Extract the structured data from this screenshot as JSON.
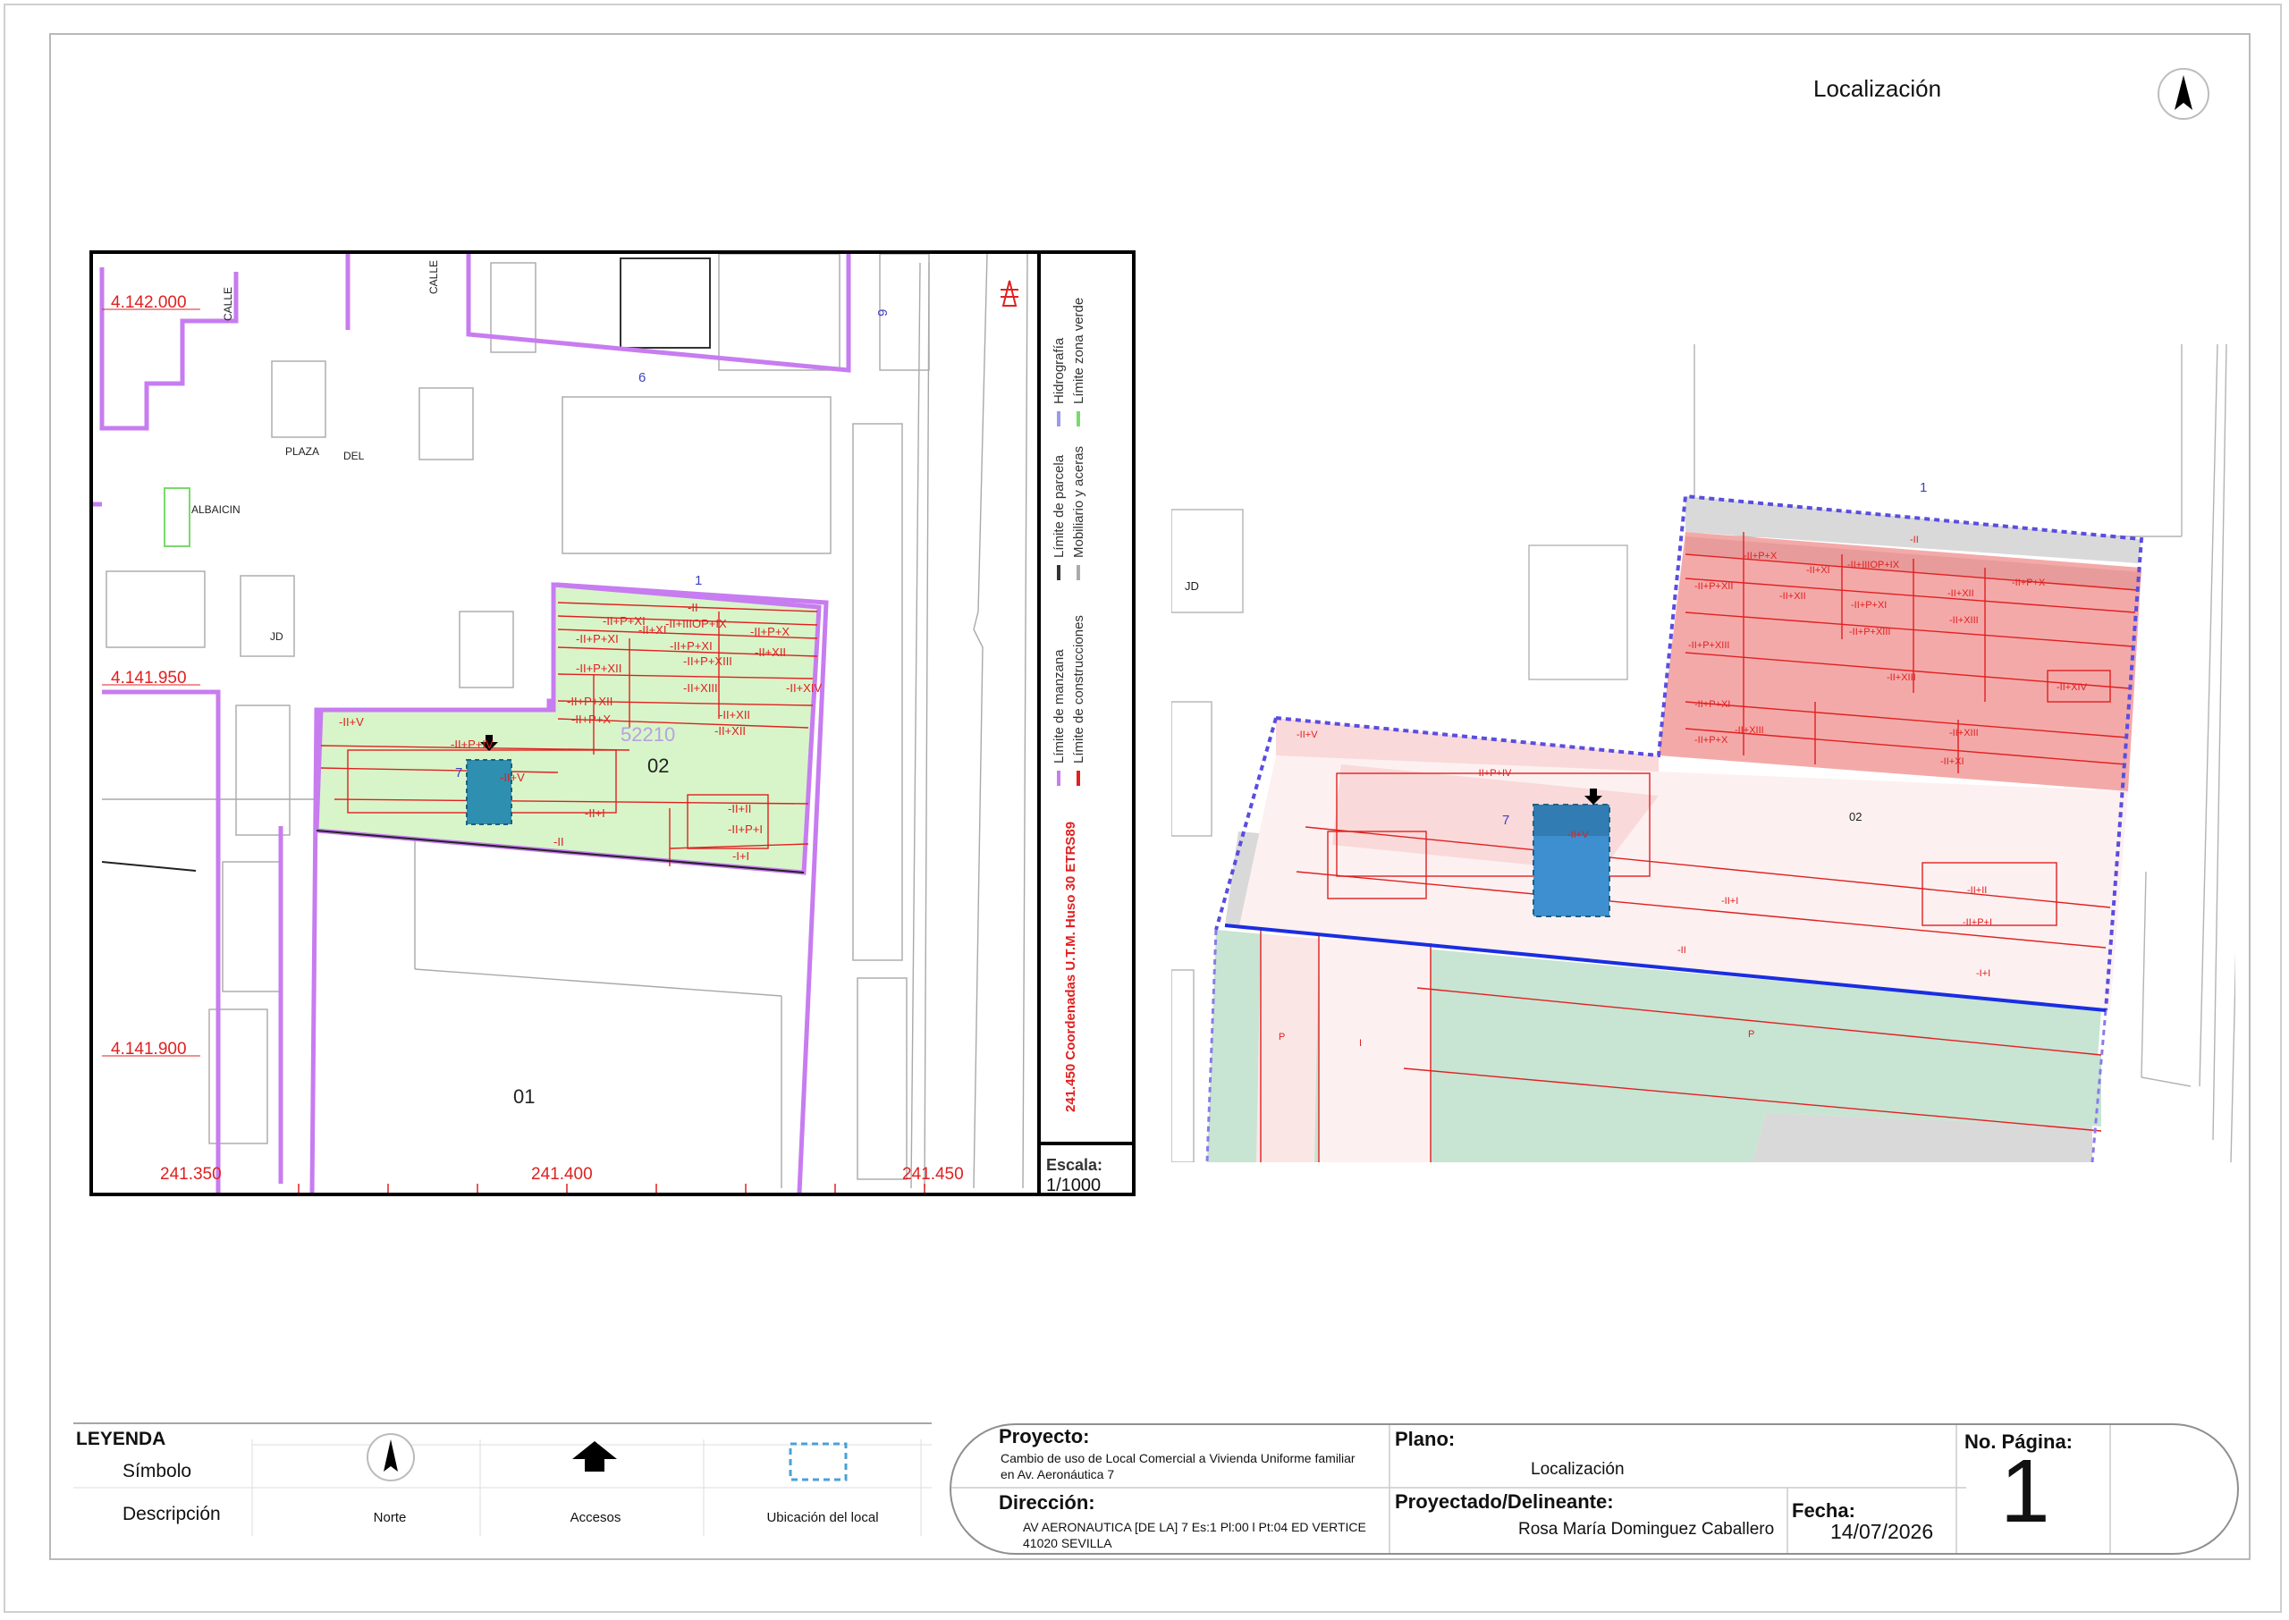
{
  "sheet": {
    "title": "Localización"
  },
  "left_map": {
    "coords": {
      "y_top": "4.142.000",
      "y_mid": "4.141.950",
      "y_low": "4.141.900",
      "x_left": "241.350",
      "x_mid": "241.400",
      "x_right": "241.450"
    },
    "street_labels": [
      "CALLE",
      "CALLE",
      "PLAZA",
      "DEL",
      "ALBAICIN",
      "JD"
    ],
    "parcel_numbers": [
      "6",
      "9",
      "1",
      "7"
    ],
    "block_codes": [
      "02",
      "01",
      "52210"
    ],
    "construction_codes": [
      "-II+V",
      "-II+P+IV",
      "-II+V",
      "-II+I",
      "-II",
      "-II+II",
      "-II+P+I",
      "-I+I",
      "-II",
      "-II+P+XI",
      "-II+XI",
      "-II+P+XI",
      "-II+P+XII",
      "-II+XIII",
      "-II+XII",
      "-II+XIV",
      "-II+P+XII",
      "-II+P+X",
      "-II+P+XI",
      "-II+XIII",
      "-II+XII",
      "-II+IIIOP+IX"
    ],
    "side_legend": {
      "items": [
        "Límite de manzana",
        "Límite de construcciones",
        "Límite de parcela",
        "Mobiliario y aceras",
        "Hidrografía",
        "Límite zona verde"
      ],
      "coordinate_note": "241.450 Coordenadas U.T.M. Huso 30 ETRS89",
      "scale_label": "Escala:",
      "scale_value": "1/1000"
    }
  },
  "right_map": {
    "labels": [
      "1",
      "JD",
      "7",
      "02"
    ],
    "construction_codes": [
      "-II",
      "-II+P+X",
      "-II+XI",
      "-II+IIIOP+IX",
      "-II+P+XII",
      "-II+XII",
      "-II+P+XI",
      "-II+XII",
      "-II+P+X",
      "-II+P+XIII",
      "-II+XIII",
      "-II+XIV",
      "-II+P+XI",
      "-II+XIII",
      "-II+P+X",
      "-II+XIII",
      "-II+XI",
      "-II+V",
      "-II+P+IV",
      "-II+V",
      "-II+I",
      "-II+II",
      "-II+P+I",
      "-II",
      "-I+I",
      "P",
      "I",
      "P"
    ]
  },
  "legend": {
    "title": "LEYENDA",
    "row_symbol": "Símbolo",
    "row_description": "Descripción",
    "items": [
      {
        "icon": "north-arrow-icon",
        "label": "Norte"
      },
      {
        "icon": "access-arrow-icon",
        "label": "Accesos"
      },
      {
        "icon": "dashed-rectangle-icon",
        "label": "Ubicación del local"
      }
    ]
  },
  "title_block": {
    "proyecto_label": "Proyecto:",
    "proyecto_line1": "Cambio de uso de Local Comercial a Vivienda Uniforme familiar",
    "proyecto_line2": "en Av. Aeronáutica 7",
    "plano_label": "Plano:",
    "plano_value": "Localización",
    "pagina_label": "No. Página:",
    "pagina_value": "1",
    "direccion_label": "Dirección:",
    "direccion_line1": "AV AERONAUTICA [DE LA] 7 Es:1 Pl:00 l Pt:04 ED VERTICE",
    "direccion_line2": "41020 SEVILLA",
    "proyectado_label": "Proyectado/Delineante:",
    "proyectado_value": "Rosa María Dominguez Caballero",
    "fecha_label": "Fecha:",
    "fecha_value": "14/07/2026"
  },
  "colors": {
    "block_limit": "#c77cf0",
    "construction_limit": "#e02020",
    "green_zone": "#d7f5c9",
    "local_blue": "#3d8fd0",
    "pink_fill": "#f9d9d9",
    "red_fill": "#f4a9a9",
    "grey_fill": "#d9d9d9",
    "green_right": "#c8e4d3"
  }
}
